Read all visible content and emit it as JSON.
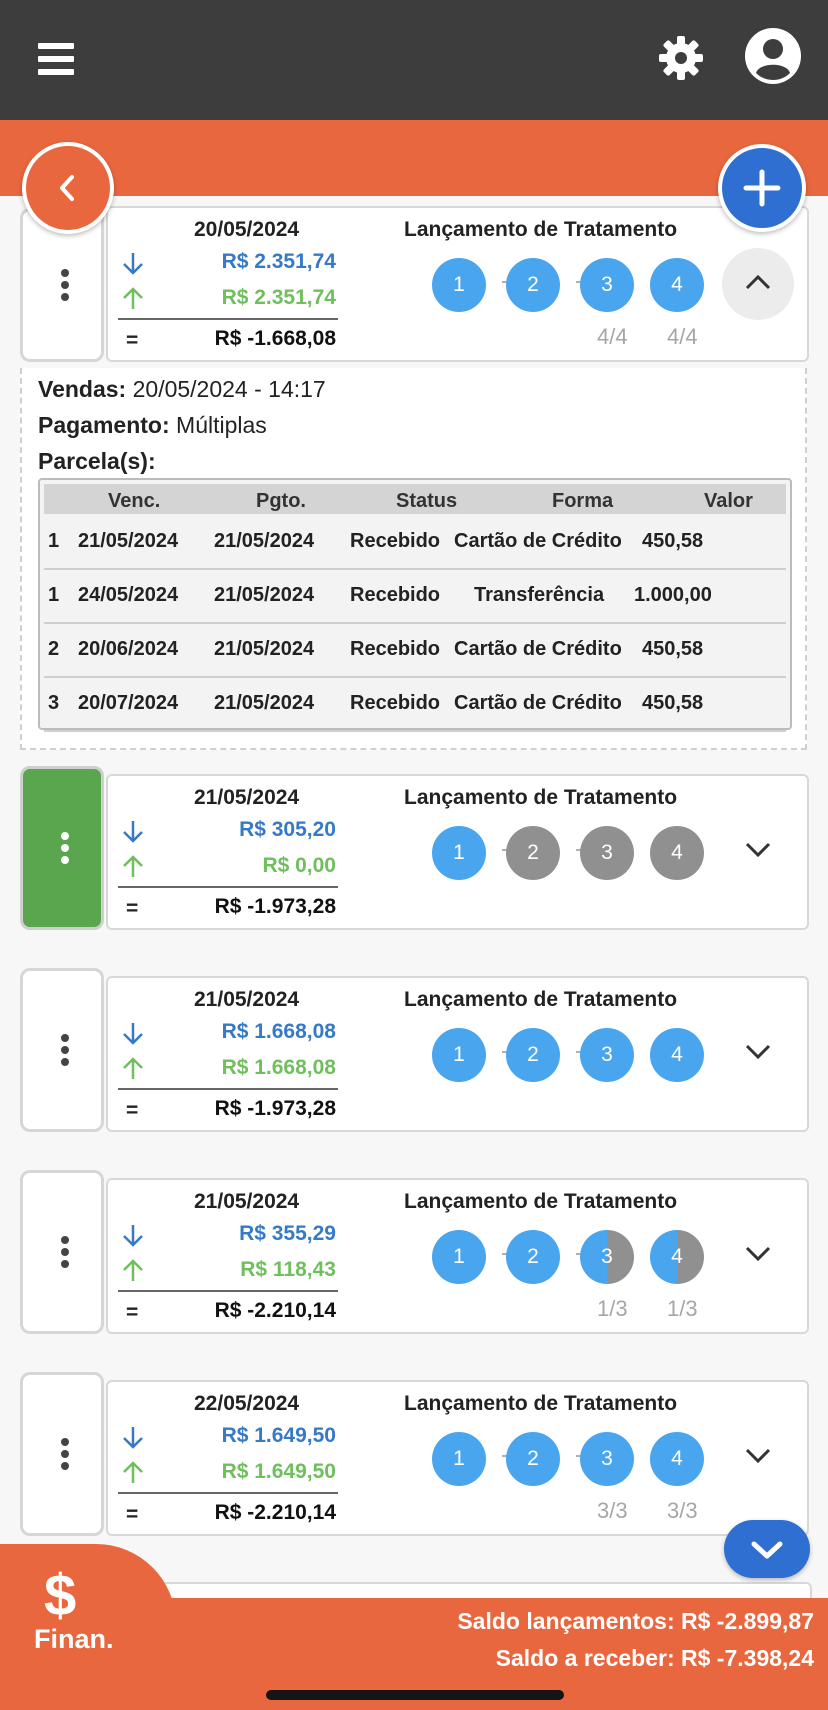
{
  "colors": {
    "header_bg": "#3d3d3d",
    "accent_orange": "#e8673f",
    "primary_blue": "#2f6fd1",
    "step_blue": "#4aa5ef",
    "step_grey": "#909090",
    "entrada_blue": "#3679c6",
    "saida_green": "#6fbf5d",
    "selected_green": "#5aa64f"
  },
  "header": {
    "menu_icon": "hamburger-icon",
    "settings_icon": "gear-icon",
    "profile_icon": "user-circle-icon"
  },
  "cards": [
    {
      "date": "20/05/2024",
      "in": "R$ 2.351,74",
      "out": "R$ 2.351,74",
      "total": "R$ -1.668,08",
      "title": "Lançamento de Tratamento",
      "steps": [
        "1",
        "2",
        "3",
        "4"
      ],
      "step_states": [
        "done",
        "done",
        "done",
        "done"
      ],
      "frac3": "4/4",
      "frac4": "4/4",
      "expanded": true
    },
    {
      "date": "21/05/2024",
      "in": "R$ 305,20",
      "out": "R$ 0,00",
      "total": "R$ -1.973,28",
      "title": "Lançamento de Tratamento",
      "steps": [
        "1",
        "2",
        "3",
        "4"
      ],
      "step_states": [
        "done",
        "pending",
        "pending",
        "pending"
      ],
      "frac3": "",
      "frac4": "",
      "selected": true
    },
    {
      "date": "21/05/2024",
      "in": "R$ 1.668,08",
      "out": "R$ 1.668,08",
      "total": "R$ -1.973,28",
      "title": "Lançamento de Tratamento",
      "steps": [
        "1",
        "2",
        "3",
        "4"
      ],
      "step_states": [
        "done",
        "done",
        "done",
        "done"
      ],
      "frac3": "",
      "frac4": ""
    },
    {
      "date": "21/05/2024",
      "in": "R$ 355,29",
      "out": "R$ 118,43",
      "total": "R$ -2.210,14",
      "title": "Lançamento de Tratamento",
      "steps": [
        "1",
        "2",
        "3",
        "4"
      ],
      "step_states": [
        "done",
        "done",
        "partial",
        "partial"
      ],
      "frac3": "1/3",
      "frac4": "1/3"
    },
    {
      "date": "22/05/2024",
      "in": "R$ 1.649,50",
      "out": "R$ 1.649,50",
      "total": "R$ -2.210,14",
      "title": "Lançamento de Tratamento",
      "steps": [
        "1",
        "2",
        "3",
        "4"
      ],
      "step_states": [
        "done",
        "done",
        "done",
        "done"
      ],
      "frac3": "3/3",
      "frac4": "3/3"
    }
  ],
  "details": {
    "vendas_label": "Vendas:",
    "vendas_value": "20/05/2024 - 14:17",
    "pagamento_label": "Pagamento:",
    "pagamento_value": "Múltiplas",
    "parcelas_label": "Parcela(s):",
    "columns": [
      "Venc.",
      "Pgto.",
      "Status",
      "Forma",
      "Valor"
    ],
    "rows": [
      {
        "n": "1",
        "venc": "21/05/2024",
        "pgto": "21/05/2024",
        "status": "Recebido",
        "forma": "Cartão de Crédito",
        "valor": "450,58"
      },
      {
        "n": "1",
        "venc": "24/05/2024",
        "pgto": "21/05/2024",
        "status": "Recebido",
        "forma": "Transferência",
        "valor": "1.000,00"
      },
      {
        "n": "2",
        "venc": "20/06/2024",
        "pgto": "21/05/2024",
        "status": "Recebido",
        "forma": "Cartão de Crédito",
        "valor": "450,58"
      },
      {
        "n": "3",
        "venc": "20/07/2024",
        "pgto": "21/05/2024",
        "status": "Recebido",
        "forma": "Cartão de Crédito",
        "valor": "450,58"
      }
    ]
  },
  "footer": {
    "tab_icon": "$",
    "tab_label": "Finan.",
    "saldo_lancamentos": "Saldo lançamentos: R$ -2.899,87",
    "saldo_receber": "Saldo a receber: R$ -7.398,24"
  }
}
